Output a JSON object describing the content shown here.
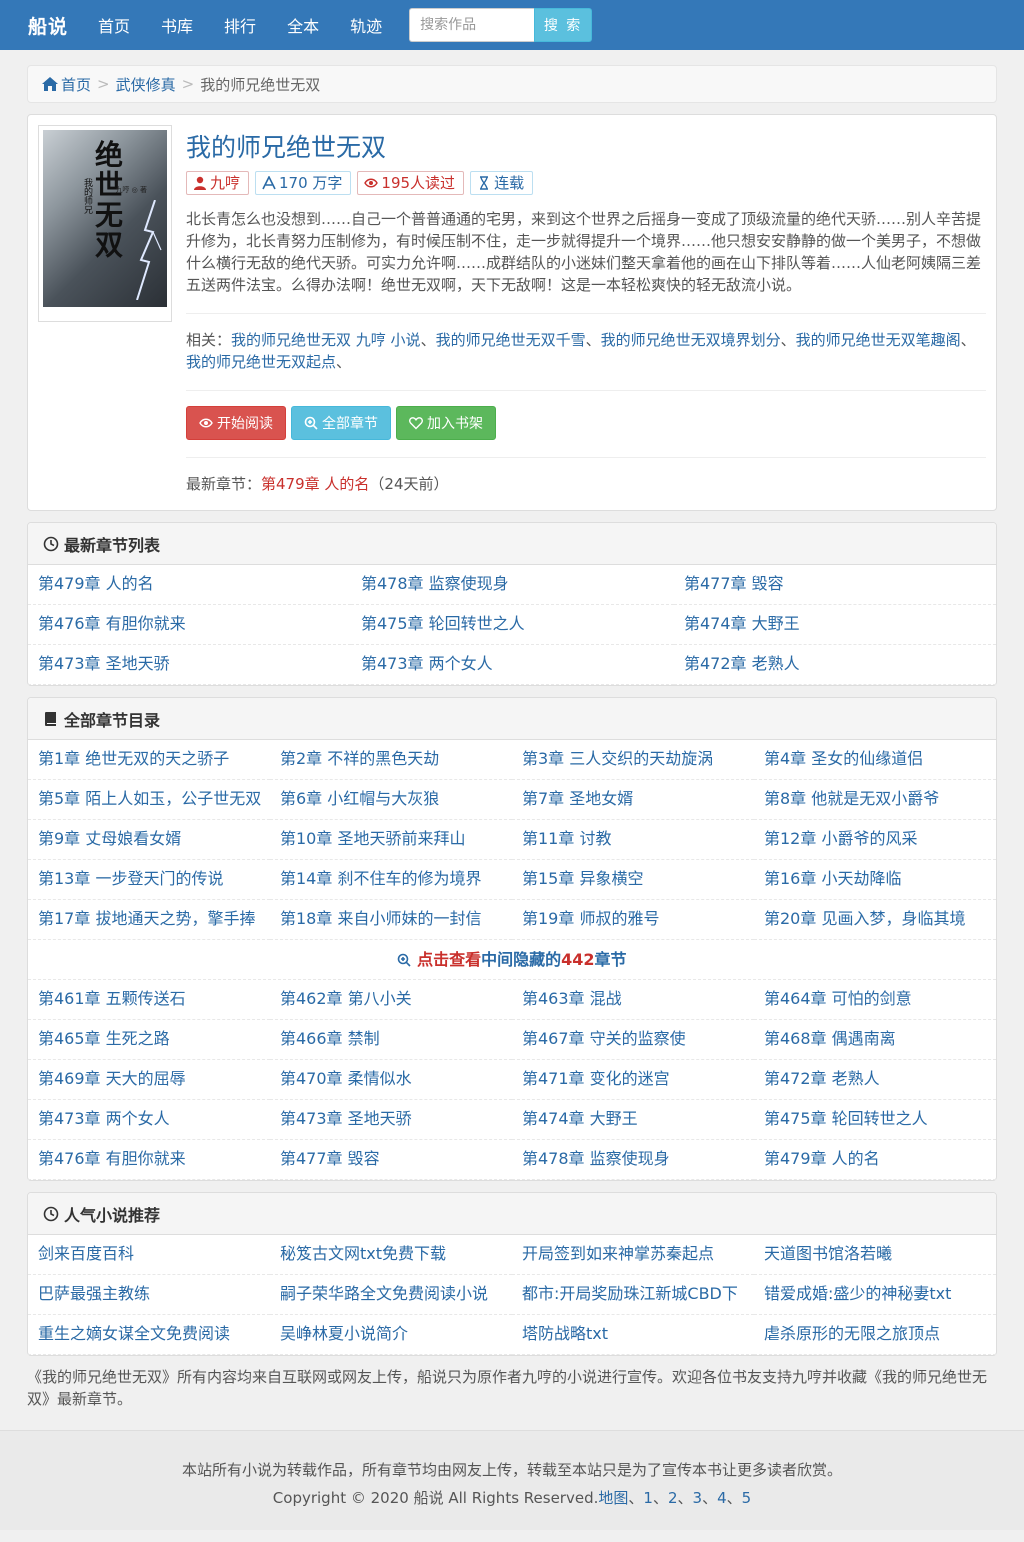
{
  "nav": {
    "logo": "船说",
    "items": [
      "首页",
      "书库",
      "排行",
      "全本",
      "轨迹"
    ],
    "search_placeholder": "搜索作品",
    "search_button": "搜 索"
  },
  "breadcrumb": {
    "home": "首页",
    "category": "武侠修真",
    "current": "我的师兄绝世无双"
  },
  "book": {
    "cover": {
      "title": "绝世无双",
      "subtitle": "我的师兄",
      "author": "九哼 ◎ 著"
    },
    "title": "我的师兄绝世无双",
    "tags": {
      "author": "九哼",
      "words": "170 万字",
      "readers": "195人读过",
      "status": "连载"
    },
    "intro": "北长青怎么也没想到……自己一个普普通通的宅男，来到这个世界之后摇身一变成了顶级流量的绝代天骄……别人辛苦提升修为，北长青努力压制修为，有时候压制不住，走一步就得提升一个境界……他只想安安静静的做一个美男子，不想做什么横行无敌的绝代天骄。可实力允许啊……成群结队的小迷妹们整天拿着他的画在山下排队等着……人仙老阿姨隔三差五送两件法宝。么得办法啊！绝世无双啊，天下无敌啊！这是一本轻松爽快的轻无敌流小说。",
    "related_label": "相关：",
    "related": [
      "我的师兄绝世无双 九哼 小说",
      "我的师兄绝世无双千雪",
      "我的师兄绝世无双境界划分",
      "我的师兄绝世无双笔趣阁",
      "我的师兄绝世无双起点"
    ],
    "buttons": {
      "read": "开始阅读",
      "chapters": "全部章节",
      "shelf": "加入书架"
    },
    "latest_label": "最新章节：",
    "latest_chapter": "第479章 人的名",
    "latest_time": "（24天前）"
  },
  "latest_list": {
    "title": "最新章节列表",
    "items": [
      "第479章 人的名",
      "第478章 监察使现身",
      "第477章 毁容",
      "第476章 有胆你就来",
      "第475章 轮回转世之人",
      "第474章 大野王",
      "第473章 圣地天骄",
      "第473章 两个女人",
      "第472章 老熟人"
    ]
  },
  "all_list": {
    "title": "全部章节目录",
    "top": [
      "第1章 绝世无双的天之骄子",
      "第2章 不祥的黑色天劫",
      "第3章 三人交织的天劫旋涡",
      "第4章 圣女的仙缘道侣",
      "第5章 陌上人如玉，公子世无双",
      "第6章 小红帽与大灰狼",
      "第7章 圣地女婿",
      "第8章 他就是无双小爵爷",
      "第9章 丈母娘看女婿",
      "第10章 圣地天骄前来拜山",
      "第11章 讨教",
      "第12章 小爵爷的风采",
      "第13章 一步登天门的传说",
      "第14章 刹不住车的修为境界",
      "第15章 异象横空",
      "第16章 小天劫降临",
      "第17章 拔地通天之势，擎手捧",
      "第18章 来自小师妹的一封信",
      "第19章 师叔的雅号",
      "第20章 见画入梦，身临其境"
    ],
    "hidden_a": "点击查看",
    "hidden_b": "中间隐藏的",
    "hidden_count": "442",
    "hidden_c": "章节",
    "bottom": [
      "第461章 五颗传送石",
      "第462章 第八小关",
      "第463章 混战",
      "第464章 可怕的剑意",
      "第465章 生死之路",
      "第466章 禁制",
      "第467章 守关的监察使",
      "第468章 偶遇南离",
      "第469章 天大的屈辱",
      "第470章 柔情似水",
      "第471章 变化的迷宫",
      "第472章 老熟人",
      "第473章 两个女人",
      "第473章 圣地天骄",
      "第474章 大野王",
      "第475章 轮回转世之人",
      "第476章 有胆你就来",
      "第477章 毁容",
      "第478章 监察使现身",
      "第479章 人的名"
    ]
  },
  "popular": {
    "title": "人气小说推荐",
    "items": [
      "剑来百度百科",
      "秘笈古文网txt免费下载",
      "开局签到如来神掌苏秦起点",
      "天道图书馆洛若曦",
      "巴萨最强主教练",
      "嗣子荣华路全文免费阅读小说",
      "都市:开局奖励珠江新城CBD下",
      "错爱成婚:盛少的神秘妻txt",
      "重生之嫡女谋全文免费阅读",
      "吴峥林夏小说简介",
      "塔防战略txt",
      "虐杀原形的无限之旅顶点"
    ]
  },
  "description": "《我的师兄绝世无双》所有内容均来自互联网或网友上传，船说只为原作者九哼的小说进行宣传。欢迎各位书友支持九哼并收藏《我的师兄绝世无双》最新章节。",
  "footer": {
    "line1": "本站所有小说为转载作品，所有章节均由网友上传，转载至本站只是为了宣传本书让更多读者欣赏。",
    "copyright": "Copyright © 2020 船说 All Rights Reserved.",
    "links": [
      "地图",
      "1",
      "2",
      "3",
      "4",
      "5"
    ]
  },
  "colors": {
    "nav_bg": "#3478b8",
    "link": "#2a6aa6",
    "red": "#c9302c",
    "btn_red": "#d9534f",
    "btn_cyan": "#5bc0de",
    "btn_green": "#5cb85c"
  }
}
